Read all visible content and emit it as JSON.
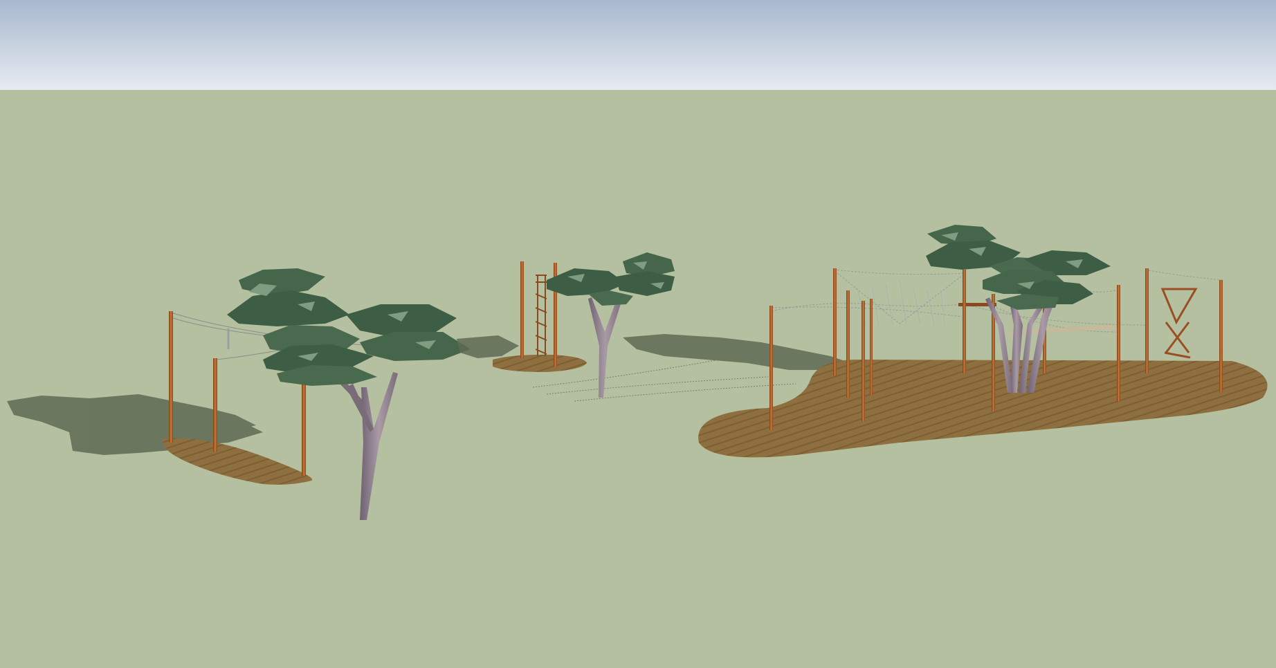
{
  "app": {
    "view": "3d-model-viewport"
  },
  "colors": {
    "sky_top": "#a8b8cd",
    "sky_bottom": "#e6ebf1",
    "ground": "#b4c09f",
    "pad_fill": "#8e6f3f",
    "pad_stripe": "#7d5f33",
    "pole": "#b5652b",
    "pole_shadow": "#7e3f17",
    "cable": "#8a8a8a",
    "shadow": "#5f6a55",
    "foliage_dark": "#3d5e44",
    "foliage_light": "#6f8f72",
    "trunk": "#8e7d8a"
  },
  "objects": {
    "pads": [
      "pad-left",
      "pad-middle",
      "pad-right"
    ],
    "trees": [
      "tree-left",
      "tree-middle",
      "tree-right"
    ],
    "ladders": [
      "ladder-middle",
      "ladder-right"
    ]
  }
}
